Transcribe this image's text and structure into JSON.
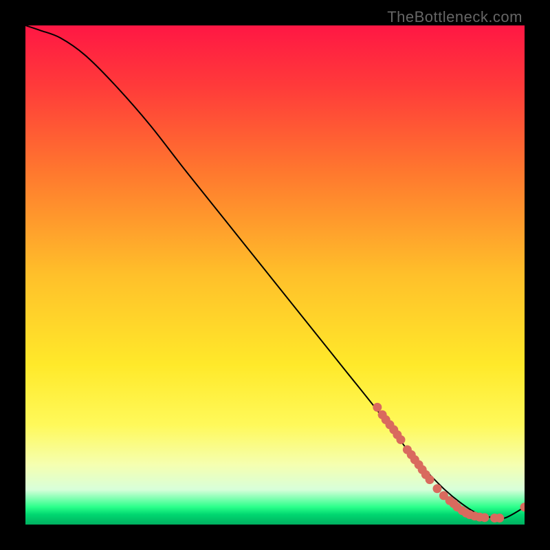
{
  "watermark": "TheBottleneck.com",
  "chart_data": {
    "type": "line",
    "title": "",
    "xlabel": "",
    "ylabel": "",
    "xlim": [
      0,
      100
    ],
    "ylim": [
      0,
      100
    ],
    "background_gradient": {
      "stops": [
        {
          "pos": 0.0,
          "color": "#ff1744"
        },
        {
          "pos": 0.12,
          "color": "#ff3a3a"
        },
        {
          "pos": 0.3,
          "color": "#ff7a2e"
        },
        {
          "pos": 0.5,
          "color": "#ffc02a"
        },
        {
          "pos": 0.68,
          "color": "#ffe92a"
        },
        {
          "pos": 0.8,
          "color": "#fff95a"
        },
        {
          "pos": 0.88,
          "color": "#f5ffb0"
        },
        {
          "pos": 0.93,
          "color": "#d8ffda"
        },
        {
          "pos": 0.965,
          "color": "#2aff8a"
        },
        {
          "pos": 0.98,
          "color": "#00d770"
        },
        {
          "pos": 1.0,
          "color": "#00b060"
        }
      ]
    },
    "curve": {
      "x": [
        0,
        3,
        7,
        12,
        18,
        25,
        32,
        40,
        48,
        56,
        64,
        70,
        75,
        78,
        81,
        84,
        87,
        90,
        93,
        96,
        100
      ],
      "y": [
        100,
        99,
        97.5,
        94,
        88,
        80,
        71,
        61,
        51,
        41,
        31,
        23.5,
        17,
        13,
        10,
        7,
        4.5,
        2.5,
        1.5,
        1.3,
        3.5
      ]
    },
    "scatter_points": [
      {
        "x": 70.5,
        "y": 23.5
      },
      {
        "x": 71.5,
        "y": 22.0
      },
      {
        "x": 72.2,
        "y": 21.0
      },
      {
        "x": 73.0,
        "y": 20.0
      },
      {
        "x": 73.8,
        "y": 19.0
      },
      {
        "x": 74.5,
        "y": 18.0
      },
      {
        "x": 75.2,
        "y": 17.0
      },
      {
        "x": 76.5,
        "y": 15.0
      },
      {
        "x": 77.3,
        "y": 14.0
      },
      {
        "x": 78.0,
        "y": 13.0
      },
      {
        "x": 78.8,
        "y": 12.0
      },
      {
        "x": 79.5,
        "y": 11.0
      },
      {
        "x": 80.2,
        "y": 10.0
      },
      {
        "x": 81.0,
        "y": 9.0
      },
      {
        "x": 82.5,
        "y": 7.2
      },
      {
        "x": 83.8,
        "y": 5.8
      },
      {
        "x": 85.0,
        "y": 4.8
      },
      {
        "x": 85.8,
        "y": 4.2
      },
      {
        "x": 86.5,
        "y": 3.5
      },
      {
        "x": 87.5,
        "y": 2.8
      },
      {
        "x": 88.3,
        "y": 2.3
      },
      {
        "x": 89.0,
        "y": 2.0
      },
      {
        "x": 90.0,
        "y": 1.7
      },
      {
        "x": 91.0,
        "y": 1.5
      },
      {
        "x": 92.0,
        "y": 1.4
      },
      {
        "x": 94.0,
        "y": 1.3
      },
      {
        "x": 95.0,
        "y": 1.3
      },
      {
        "x": 100.0,
        "y": 3.5
      }
    ],
    "point_color": "#d96a5e"
  }
}
